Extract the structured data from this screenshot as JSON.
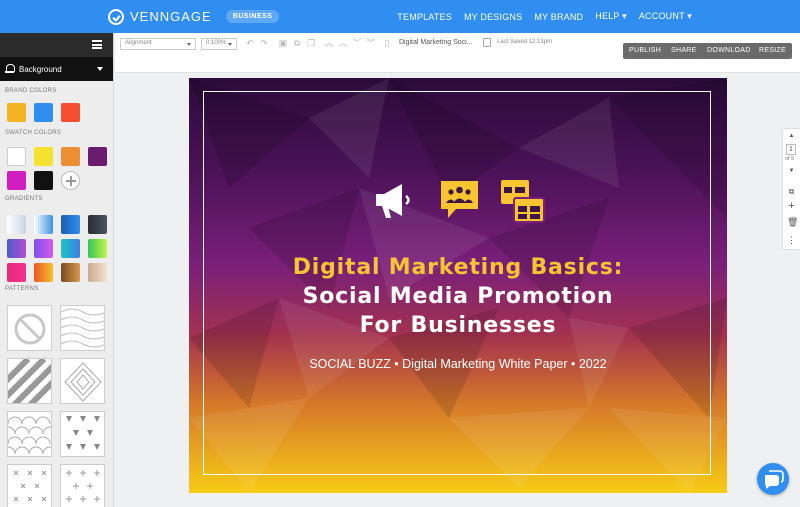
{
  "app": {
    "brand": "VENNGAGE",
    "badge": "BUSINESS",
    "nav": [
      "TEMPLATES",
      "MY DESIGNS",
      "MY BRAND",
      "HELP ▾",
      "ACCOUNT ▾"
    ]
  },
  "sidebar": {
    "panel_label": "Background",
    "sections": {
      "brand_colors": "BRAND COLORS",
      "swatch_colors": "SWATCH COLORS",
      "gradients": "GRADIENTS",
      "patterns": "PATTERNS"
    },
    "brand_colors": [
      "#f2b324",
      "#2f8ef0",
      "#f24e2f"
    ],
    "swatch_colors": [
      "#ffffff",
      "#f5e12f",
      "#ec8f33",
      "#6a1c6e",
      "#d11fbf",
      "#111111"
    ],
    "gradients": [
      [
        "#ffffff",
        "#c9d4e2"
      ],
      [
        "#ffffff",
        "#3a93e0"
      ],
      [
        "#1b5fb5",
        "#2f8ef0"
      ],
      [
        "#2b2f36",
        "#4a525c"
      ],
      [
        "#4e5cc5",
        "#b24cd6"
      ],
      [
        "#7e4ff0",
        "#d55be8"
      ],
      [
        "#1fc5c0",
        "#3d7fe6"
      ],
      [
        "#34c45a",
        "#c3f54a"
      ],
      [
        "#e82c7b",
        "#f0338a"
      ],
      [
        "#f0562d",
        "#f5c02c"
      ],
      [
        "#7a4a22",
        "#d99a4e"
      ],
      [
        "#c9a98a",
        "#f2e3d2"
      ]
    ]
  },
  "toolbar": {
    "align_select": "Alignment",
    "zoom_select": "0:100%",
    "doc_title": "Digital Marketing Soci...",
    "last_saved": "Last Saved 12:13pm",
    "buttons": [
      "PUBLISH",
      "SHARE",
      "DOWNLOAD",
      "RESIZE"
    ]
  },
  "canvas": {
    "headline_1": "Digital Marketing Basics:",
    "headline_2": "Social Media Promotion",
    "headline_3": "For Businesses",
    "subline": "SOCIAL BUZZ • Digital Marketing White Paper • 2022",
    "colors": {
      "top": "#2b0b3a",
      "mid": "#7a1f7a",
      "lower": "#c2482e",
      "bottom": "#f7cc16",
      "accent": "#f7c531"
    },
    "icons": [
      "megaphone-icon",
      "group-chat-icon",
      "layout-windows-icon"
    ]
  },
  "right_rail": {
    "page_current": "1",
    "page_of": "of 5"
  }
}
